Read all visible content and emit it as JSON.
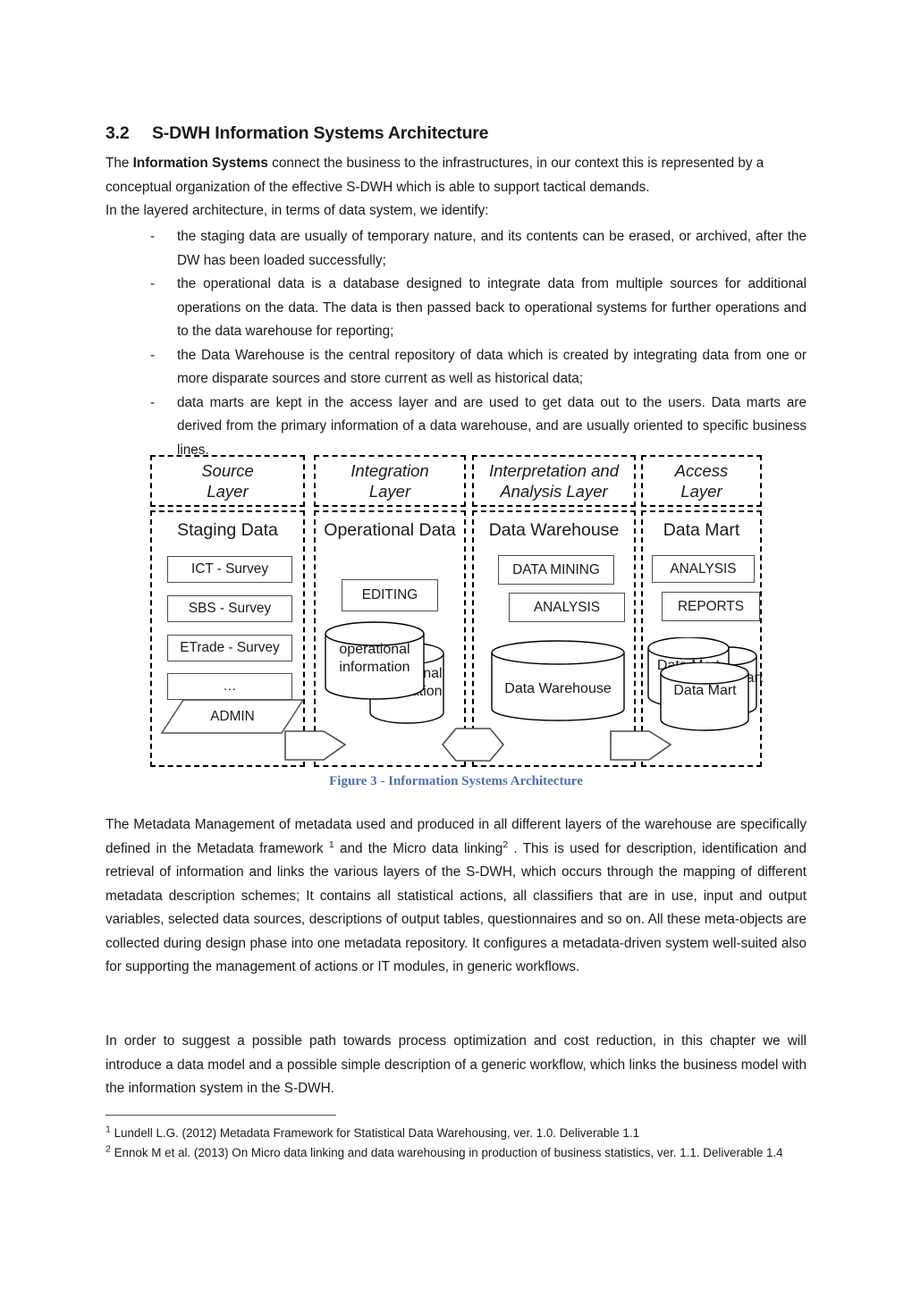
{
  "heading": {
    "number": "3.2",
    "title": "S-DWH Information Systems Architecture"
  },
  "intro": {
    "line1_pre": "The ",
    "line1_bold": "Information Systems",
    "line1_post": " connect the business to the infrastructures, in our context this is represented by a conceptual organization of the effective S-DWH which is able to support tactical demands.",
    "line2": "In the layered architecture, in terms of data system, we identify:"
  },
  "bullets": {
    "marker": "-",
    "items": [
      "the staging data are usually of temporary nature, and its contents can be erased, or archived, after the DW has been loaded successfully;",
      "the operational data is a database designed to integrate data from multiple sources for additional operations on the data. The data is then passed back to operational systems for further operations and to the data warehouse for reporting;",
      "the Data Warehouse is the central repository of data which is created by integrating data from one or more disparate sources and store current as well as historical data;",
      "data marts are kept in the access layer and are used to get data out to the users. Data marts are derived from the primary information of a data warehouse, and are usually oriented to specific business lines."
    ]
  },
  "figure": {
    "caption": "Figure 3 - Information Systems Architecture",
    "caption_color": "#4a74a8",
    "columns": [
      {
        "header": "Source\nLayer",
        "title": "Staging Data",
        "boxes": [
          "ICT - Survey",
          "SBS - Survey",
          "ETrade - Survey",
          "…"
        ],
        "parallelogram": "ADMIN"
      },
      {
        "header": "Integration\nLayer",
        "title": "Operational Data",
        "boxes": [
          "EDITING"
        ],
        "cylinders": [
          "operational\ninformation",
          "operational\ninformation"
        ]
      },
      {
        "header": "Interpretation and\nAnalysis Layer",
        "title": "Data Warehouse",
        "boxes": [
          "DATA MINING",
          "ANALYSIS"
        ],
        "cylinders": [
          "Data Warehouse"
        ]
      },
      {
        "header": "Access\nLayer",
        "title": "Data Mart",
        "boxes": [
          "ANALYSIS",
          "REPORTS"
        ],
        "cylinders": [
          "Data Mart",
          "Data Mart",
          "Data Mart"
        ]
      }
    ],
    "connectors": [
      "arrow-right",
      "hexagon",
      "arrow-right"
    ]
  },
  "paragraphs": {
    "metadata_1": "The Metadata Management of metadata used and produced in all different layers of the warehouse are specifically defined in the Metadata framework ",
    "metadata_sup1": "1",
    "metadata_2": " and the Micro data linking",
    "metadata_sup2": "2",
    "metadata_3": " . This is used for description, identification and retrieval of information and links the various layers of the S-DWH, which occurs through the mapping of different metadata description schemes; It contains all statistical actions, all classifiers that are in use, input and output variables, selected data sources, descriptions of output tables, questionnaires and so on. All these meta-objects are collected during design phase into one metadata repository. It configures a metadata-driven system well-suited also for supporting the management of actions or IT modules, in generic workflows.",
    "order": "In order to suggest a possible path towards process optimization and cost reduction, in this chapter we will introduce a data model and a possible simple description of a generic workflow, which links the business model with the information system in the S-DWH."
  },
  "footnotes": {
    "one_sup": "1",
    "one_text": " Lundell L.G. (2012) Metadata Framework for Statistical Data Warehousing, ver. 1.0. Deliverable 1.1",
    "two_sup": "2",
    "two_text": " Ennok M et al. (2013) On Micro data linking and data warehousing in production of business statistics, ver. 1.1. Deliverable 1.4"
  }
}
